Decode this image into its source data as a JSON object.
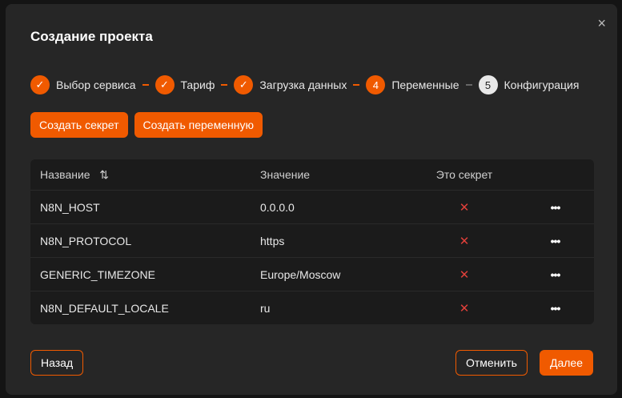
{
  "title": "Создание проекта",
  "close_icon": "×",
  "steps": [
    {
      "label": "Выбор сервиса",
      "mark": "✓"
    },
    {
      "label": "Тариф",
      "mark": "✓"
    },
    {
      "label": "Загрузка данных",
      "mark": "✓"
    },
    {
      "label": "Переменные",
      "mark": "4"
    },
    {
      "label": "Конфигурация",
      "mark": "5"
    }
  ],
  "actions": {
    "create_secret": "Создать секрет",
    "create_variable": "Создать переменную"
  },
  "table": {
    "headers": {
      "name": "Название",
      "sort_icon": "⇅",
      "value": "Значение",
      "secret": "Это секрет"
    },
    "rows": [
      {
        "name": "N8N_HOST",
        "value": "0.0.0.0",
        "secret": "✕"
      },
      {
        "name": "N8N_PROTOCOL",
        "value": "https",
        "secret": "✕"
      },
      {
        "name": "GENERIC_TIMEZONE",
        "value": "Europe/Moscow",
        "secret": "✕"
      },
      {
        "name": "N8N_DEFAULT_LOCALE",
        "value": "ru",
        "secret": "✕"
      }
    ],
    "menu_icon": "•••"
  },
  "footer": {
    "back": "Назад",
    "cancel": "Отменить",
    "next": "Далее"
  },
  "colors": {
    "accent": "#f05a00",
    "danger": "#e0403a"
  }
}
